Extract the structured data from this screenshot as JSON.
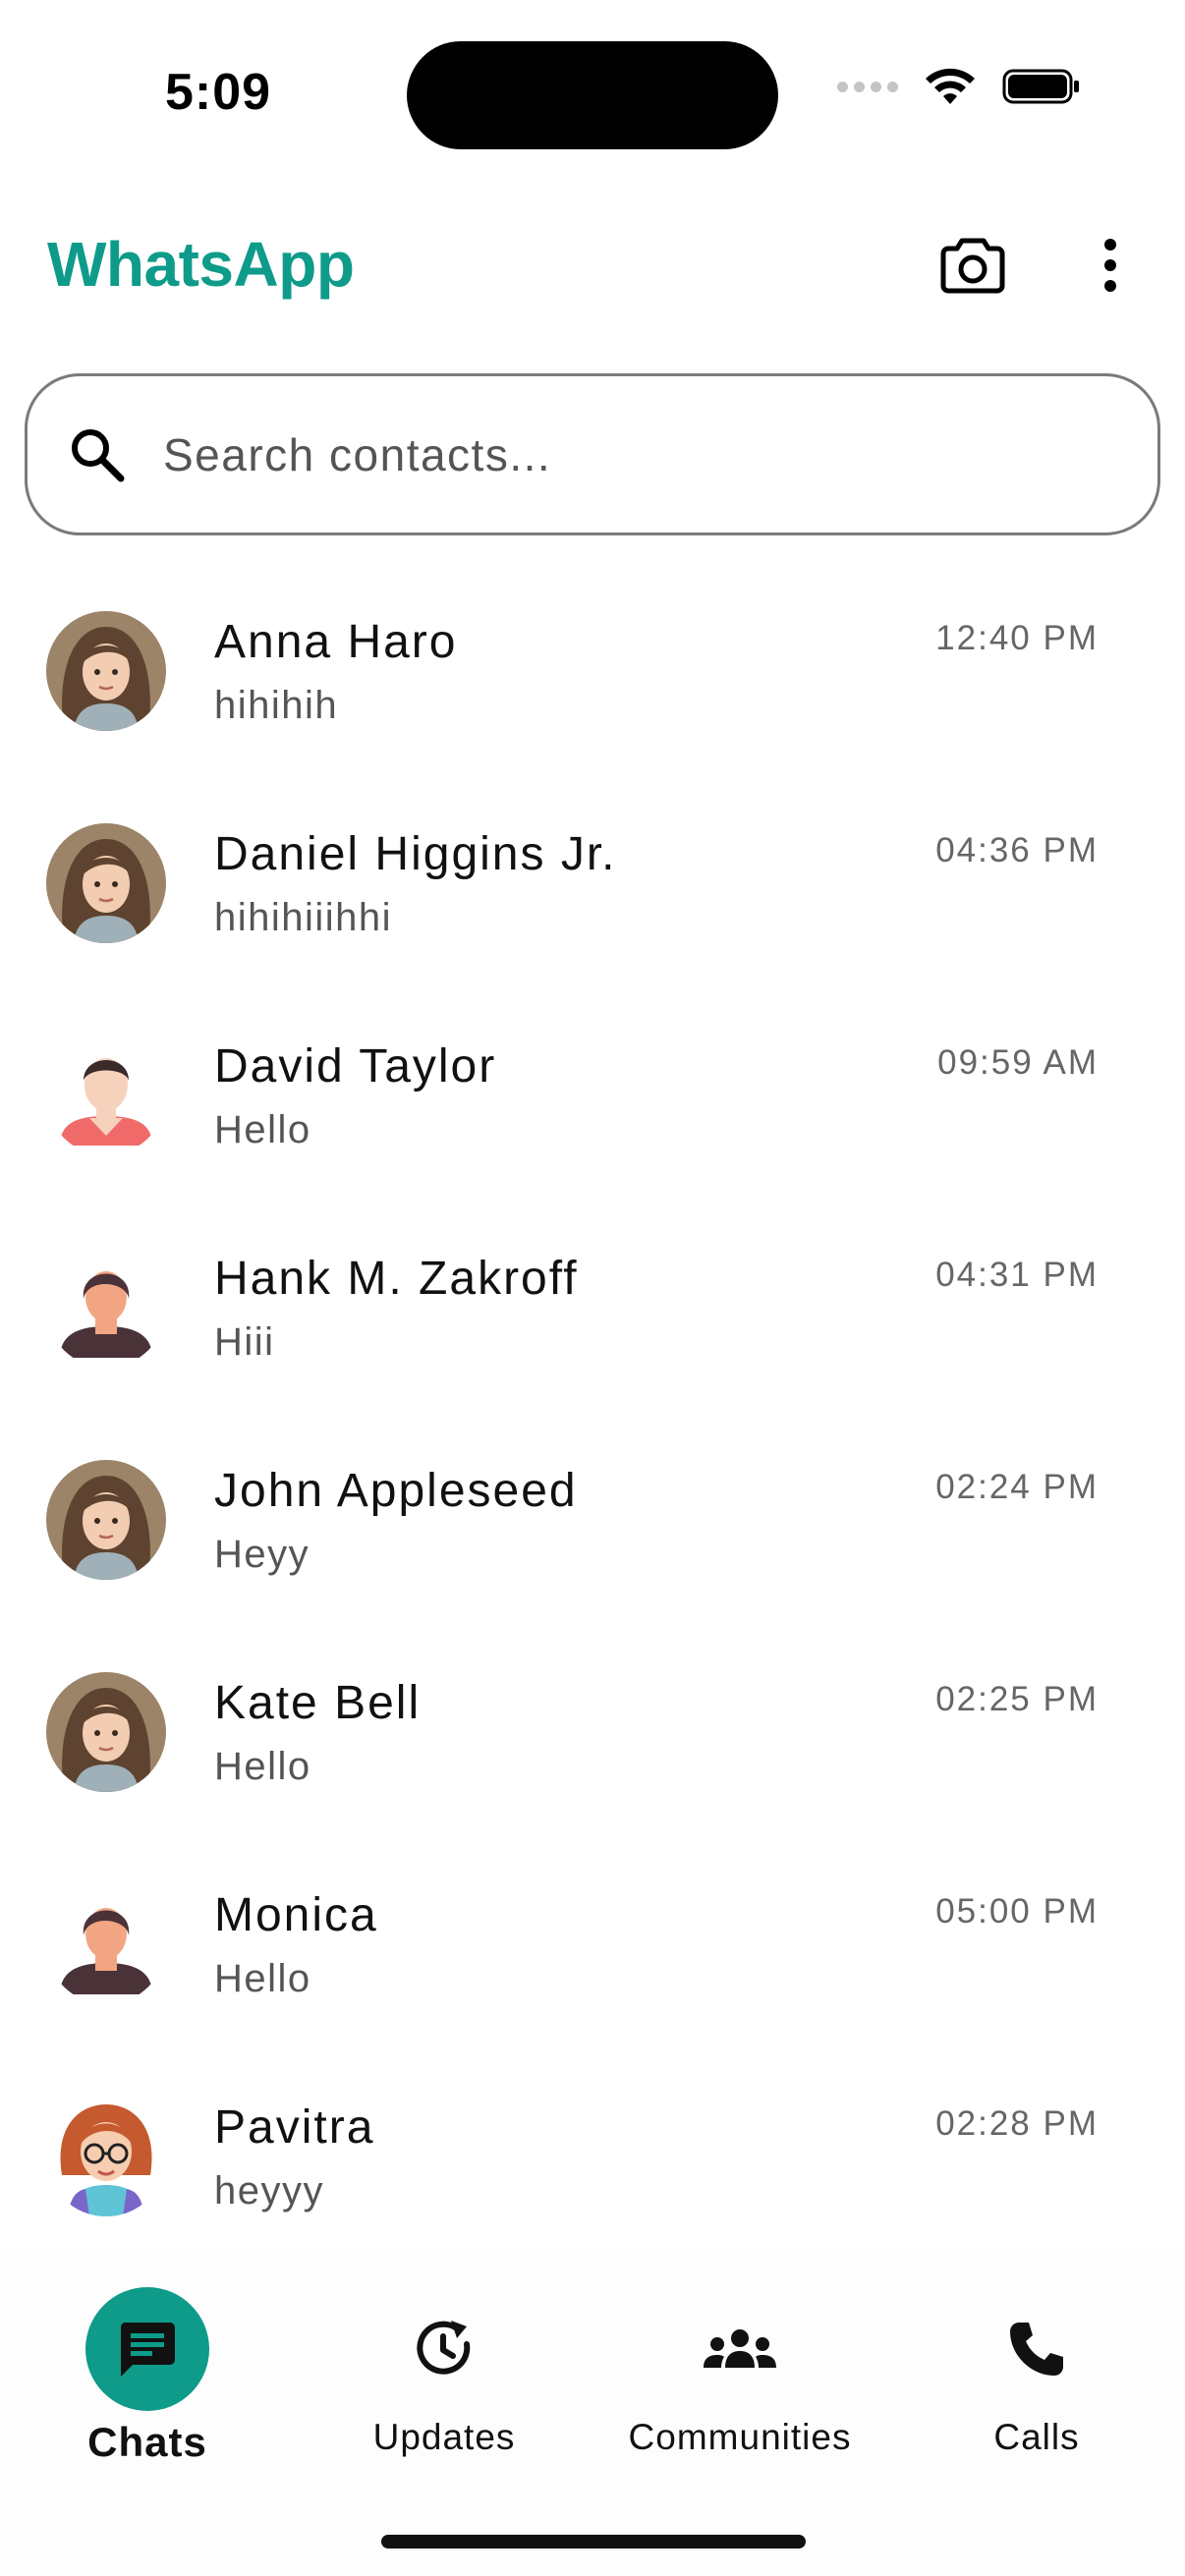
{
  "status_bar": {
    "time": "5:09"
  },
  "app_bar": {
    "title": "WhatsApp",
    "title_color": "#0e9b8a",
    "camera_icon": "camera-icon",
    "more_icon": "more-vertical-icon"
  },
  "search": {
    "placeholder": "Search contacts...",
    "value": "",
    "icon": "search-icon"
  },
  "chats": [
    {
      "name": "Anna Haro",
      "preview": "hihihih",
      "time": "12:40 PM",
      "avatar": "avatar-woman-illustration"
    },
    {
      "name": "Daniel Higgins Jr.",
      "preview": "hihihiiihhi",
      "time": "04:36 PM",
      "avatar": "avatar-woman-illustration"
    },
    {
      "name": "David Taylor",
      "preview": "Hello",
      "time": "09:59 AM",
      "avatar": "avatar-person-red"
    },
    {
      "name": "Hank M. Zakroff",
      "preview": "Hiii",
      "time": "04:31 PM",
      "avatar": "avatar-person-dark"
    },
    {
      "name": "John Appleseed",
      "preview": "Heyy",
      "time": "02:24 PM",
      "avatar": "avatar-woman-illustration"
    },
    {
      "name": "Kate Bell",
      "preview": "Hello",
      "time": "02:25 PM",
      "avatar": "avatar-woman-illustration"
    },
    {
      "name": "Monica",
      "preview": "Hello",
      "time": "05:00 PM",
      "avatar": "avatar-person-dark"
    },
    {
      "name": "Pavitra",
      "preview": "heyyy",
      "time": "02:28 PM",
      "avatar": "avatar-woman-glasses"
    }
  ],
  "bottom_nav": {
    "items": [
      {
        "label": "Chats",
        "icon": "chat-icon",
        "active": true
      },
      {
        "label": "Updates",
        "icon": "updates-icon",
        "active": false
      },
      {
        "label": "Communities",
        "icon": "communities-icon",
        "active": false
      },
      {
        "label": "Calls",
        "icon": "phone-icon",
        "active": false
      }
    ],
    "accent_color": "#0e9b8a"
  }
}
